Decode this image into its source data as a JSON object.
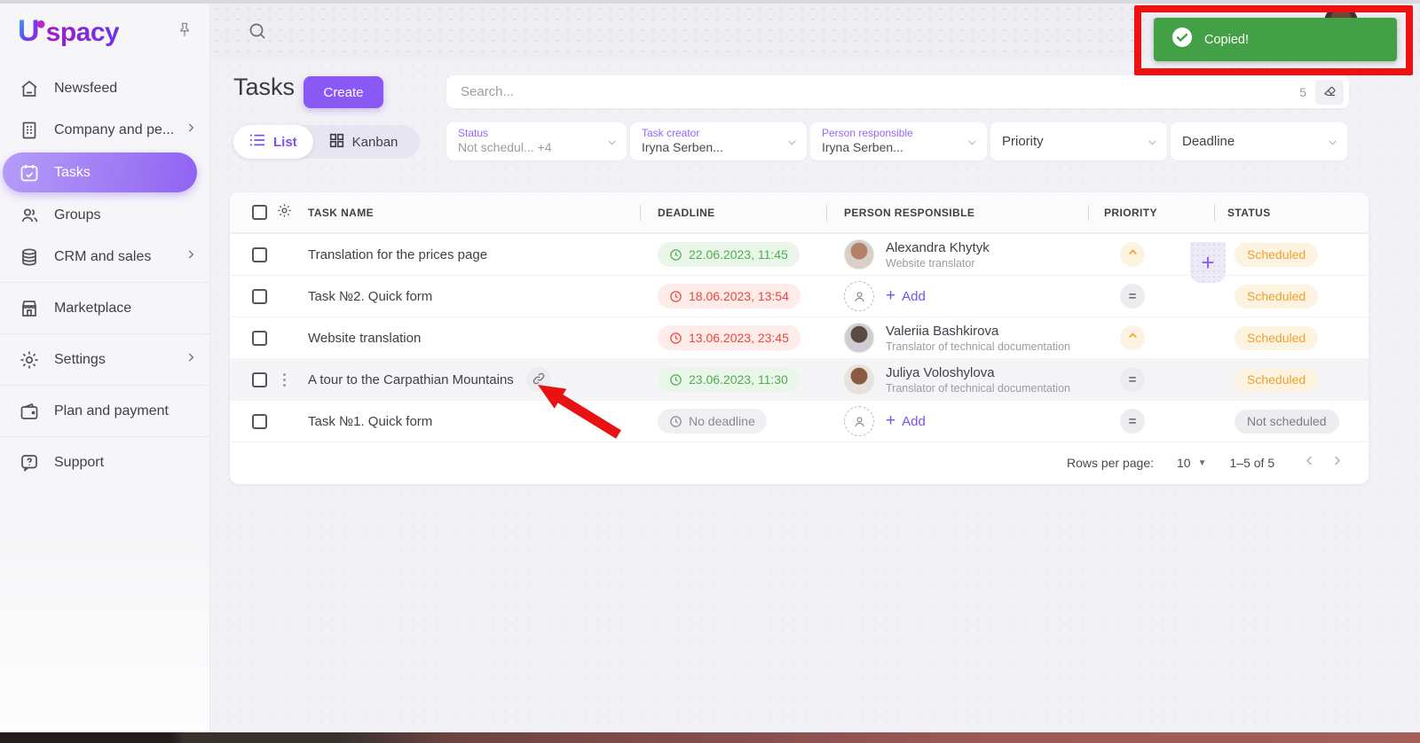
{
  "app": {
    "logo_u": "U",
    "logo_rest": "spacy"
  },
  "toast": {
    "label": "Copied!"
  },
  "page_header": {
    "title": "Tasks",
    "create_button": "Create"
  },
  "search": {
    "placeholder": "Search...",
    "count": "5"
  },
  "view_toggle": {
    "list_label": "List",
    "kanban_label": "Kanban"
  },
  "sidebar": {
    "items": [
      {
        "label": "Newsfeed"
      },
      {
        "label": "Company and pe..."
      },
      {
        "label": "Tasks"
      },
      {
        "label": "Groups"
      },
      {
        "label": "CRM and sales"
      },
      {
        "label": "Marketplace"
      },
      {
        "label": "Settings"
      },
      {
        "label": "Plan and payment"
      },
      {
        "label": "Support"
      }
    ]
  },
  "filters": {
    "status": {
      "label": "Status",
      "value": "Not schedul...",
      "extra": "+4"
    },
    "task_creator": {
      "label": "Task creator",
      "value": "Iryna Serben..."
    },
    "person_responsible": {
      "label": "Person responsible",
      "value": "Iryna Serben..."
    },
    "priority": {
      "placeholder": "Priority"
    },
    "deadline": {
      "placeholder": "Deadline"
    }
  },
  "table": {
    "columns": {
      "task_name": "TASK NAME",
      "deadline": "DEADLINE",
      "person": "PERSON RESPONSIBLE",
      "priority": "PRIORITY",
      "status": "STATUS"
    },
    "rows": [
      {
        "name": "Translation for the prices page",
        "deadline": {
          "text": "22.06.2023, 11:45",
          "variant": "green"
        },
        "person": {
          "variant": "user",
          "name": "Alexandra Khytyk",
          "role": "Website translator"
        },
        "priority": "high",
        "status": {
          "text": "Scheduled",
          "variant": "scheduled"
        }
      },
      {
        "name": "Task №2. Quick form",
        "deadline": {
          "text": "18.06.2023, 13:54",
          "variant": "red"
        },
        "person": {
          "variant": "empty",
          "add_label": "Add"
        },
        "priority": "normal",
        "status": {
          "text": "Scheduled",
          "variant": "scheduled"
        }
      },
      {
        "name": "Website translation",
        "deadline": {
          "text": "13.06.2023, 23:45",
          "variant": "red"
        },
        "person": {
          "variant": "user",
          "name": "Valeriia Bashkirova",
          "role": "Translator of technical documentation"
        },
        "priority": "high",
        "status": {
          "text": "Scheduled",
          "variant": "scheduled"
        }
      },
      {
        "name": "A tour to the Carpathian Mountains",
        "deadline": {
          "text": "23.06.2023, 11:30",
          "variant": "green"
        },
        "person": {
          "variant": "user",
          "name": "Juliya Voloshylova",
          "role": "Translator of technical documentation"
        },
        "priority": "normal",
        "status": {
          "text": "Scheduled",
          "variant": "scheduled"
        }
      },
      {
        "name": "Task №1. Quick form",
        "deadline": {
          "text": "No deadline",
          "variant": "gray"
        },
        "person": {
          "variant": "empty",
          "add_label": "Add"
        },
        "priority": "normal",
        "status": {
          "text": "Not scheduled",
          "variant": "none"
        }
      }
    ]
  },
  "pagination": {
    "rows_per_page_label": "Rows per page:",
    "rows_per_page_value": "10",
    "range": "1–5 of 5"
  }
}
